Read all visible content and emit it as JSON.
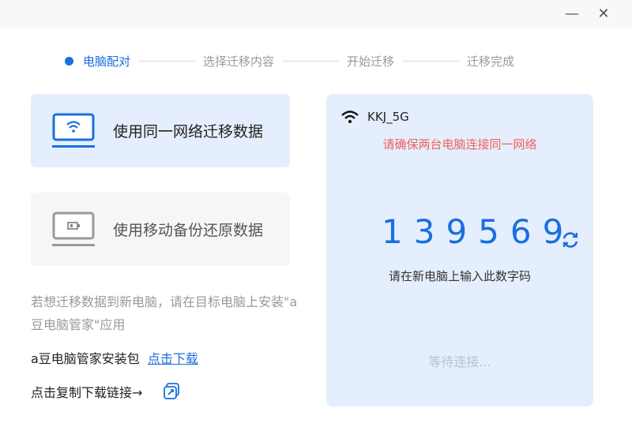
{
  "window": {
    "minimize": "—",
    "close": "✕"
  },
  "steps": [
    {
      "label": "电脑配对"
    },
    {
      "label": "选择迁移内容"
    },
    {
      "label": "开始迁移"
    },
    {
      "label": "迁移完成"
    }
  ],
  "options": [
    {
      "label": "使用同一网络迁移数据",
      "icon": "laptop-wifi-icon"
    },
    {
      "label": "使用移动备份还原数据",
      "icon": "laptop-battery-icon"
    }
  ],
  "hint": "若想迁移数据到新电脑，请在目标电脑上安装\"a豆电脑管家\"应用",
  "package": {
    "label": "a豆电脑管家安装包",
    "link": "点击下载"
  },
  "copy_link": {
    "label": "点击复制下载链接→"
  },
  "panel": {
    "network": "KKJ_5G",
    "warning": "请确保两台电脑连接同一网络",
    "code": "139569",
    "code_hint": "请在新电脑上输入此数字码",
    "status": "等待连接..."
  },
  "colors": {
    "accent": "#1a6fe0",
    "warning": "#f06262",
    "panel": "#e5eefc"
  }
}
